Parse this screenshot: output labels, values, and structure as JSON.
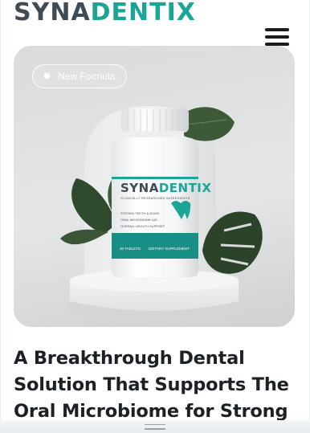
{
  "brand": {
    "part1": "SYNA",
    "part2": "DENTIX"
  },
  "menu": {
    "icon": "hamburger-icon"
  },
  "hero": {
    "badge_icon": "sparkle-icon",
    "badge_text": "New Formula",
    "bottle": {
      "brand_part1": "SYNA",
      "brand_part2": "DENTIX",
      "tagline": "CLINICALLY RESEARCHED INGREDIENTS",
      "benefits": [
        "STRONG TEETH & GUMS",
        "ORAL MICROBIOME AID",
        "OVERALL HEALTH SUPPORT"
      ],
      "count": "30 TABLETS",
      "type": "DIETARY SUPPLEMENT",
      "tooth_icon": "tooth-icon"
    }
  },
  "headline": "A Breakthrough Dental Solution That Supports The Oral Microbiome for Strong",
  "colors": {
    "brand_dark": "#3f4b55",
    "brand_teal": "#1aa596"
  }
}
